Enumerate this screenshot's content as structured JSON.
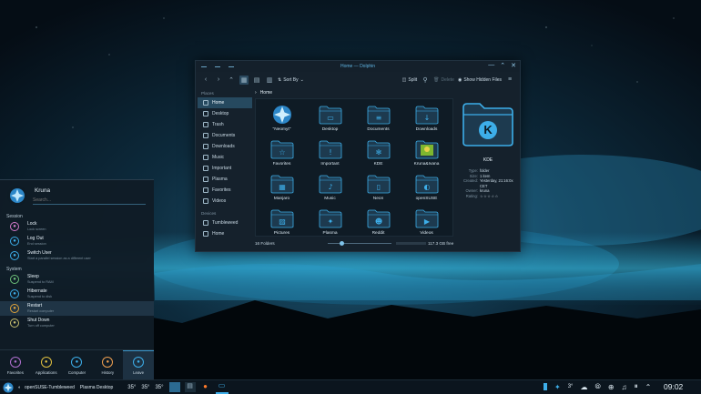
{
  "window": {
    "title": "Home — Dolphin",
    "toolbar": {
      "sort_by": "Sort By",
      "split": "Split",
      "delete": "Delete",
      "show_hidden": "Show Hidden Files"
    },
    "sidebar": {
      "places_header": "Places",
      "places": [
        "Home",
        "Desktop",
        "Trash",
        "Documents",
        "Downloads",
        "Music",
        "Important",
        "Plasma",
        "Favorites",
        "Videos"
      ],
      "devices_header": "Devices",
      "devices": [
        "Tumbleweed",
        "Home"
      ]
    },
    "breadcrumb": "Home",
    "folders": [
      "\"Neomyt\"",
      "Desktop",
      "Documents",
      "Downloads",
      "Favorites",
      "Important",
      "KDE",
      "Kruna&Ivana",
      "Manjaro",
      "Music",
      "Neon",
      "openSUSE",
      "Pictures",
      "Plasma",
      "Reddit",
      "Videos"
    ],
    "status": {
      "count": "16 Folders",
      "free": "117.3 GB free"
    },
    "info": {
      "name": "KDE",
      "rows": [
        {
          "k": "Type:",
          "v": "folder"
        },
        {
          "k": "Size:",
          "v": "1 item"
        },
        {
          "k": "Created:",
          "v": "Yesterday, 21:16:0x CET"
        },
        {
          "k": "Owner:",
          "v": "kruna"
        },
        {
          "k": "Rating:",
          "v": "☆☆☆☆☆"
        }
      ]
    }
  },
  "launcher": {
    "user": "Kruna",
    "search_placeholder": "Search...",
    "session_header": "Session",
    "system_header": "System",
    "session": [
      {
        "title": "Lock",
        "sub": "Lock screen"
      },
      {
        "title": "Log Out",
        "sub": "End session"
      },
      {
        "title": "Switch User",
        "sub": "Start a parallel session as a different user"
      }
    ],
    "system": [
      {
        "title": "Sleep",
        "sub": "Suspend to RAM"
      },
      {
        "title": "Hibernate",
        "sub": "Suspend to disk"
      },
      {
        "title": "Restart",
        "sub": "Restart computer"
      },
      {
        "title": "Shut Down",
        "sub": "Turn off computer"
      }
    ],
    "tabs": [
      "Favorites",
      "Applications",
      "Computer",
      "History",
      "Leave"
    ]
  },
  "taskbar": {
    "activity": "openSUSE-Tumbleweed",
    "desktop": "Plasma Desktop",
    "temps": [
      "35°",
      "35°",
      "35°"
    ],
    "weather": "3°",
    "clock": "09:02"
  },
  "colors": {
    "accent": "#3daee9",
    "folder": "#1f86c1",
    "window_bg": "#15212c"
  }
}
